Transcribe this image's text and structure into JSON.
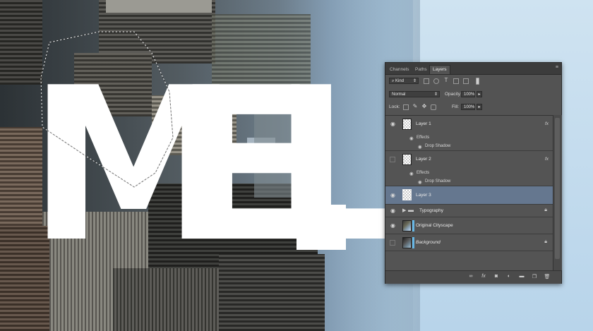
{
  "canvas_text": {
    "letter_1": "M",
    "letter_2": "E",
    "letter_3": "L"
  },
  "colors": {
    "panel_bg": "#535353",
    "selected_row": "#65778f",
    "mask_accent": "#67b7e5"
  },
  "layers_panel": {
    "tabs": [
      {
        "label": "Channels",
        "active": false
      },
      {
        "label": "Paths",
        "active": false
      },
      {
        "label": "Layers",
        "active": true
      }
    ],
    "panel_menu_icon": "panel-menu-icon",
    "filter": {
      "kind_label": "Kind",
      "icons": [
        "image-filter-icon",
        "adjustment-filter-icon",
        "type-filter-icon",
        "shape-filter-icon",
        "smart-object-filter-icon"
      ]
    },
    "blend_mode": "Normal",
    "opacity": {
      "label": "Opacity:",
      "value": "100%"
    },
    "lock": {
      "label": "Lock:",
      "icons": [
        "lock-transparent-icon",
        "lock-image-icon",
        "lock-position-icon",
        "lock-all-icon"
      ]
    },
    "fill": {
      "label": "Fill:",
      "value": "100%"
    },
    "layers": [
      {
        "name": "Layer 1",
        "visible": true,
        "selected": false,
        "fx": "fx",
        "effects_label": "Effects",
        "effect": "Drop Shadow"
      },
      {
        "name": "Layer 2",
        "visible": false,
        "selected": false,
        "fx": "fx",
        "effects_label": "Effects",
        "effect": "Drop Shadow"
      },
      {
        "name": "Layer 3",
        "visible": true,
        "selected": true
      },
      {
        "name": "Typography",
        "visible": true,
        "selected": false,
        "group": true,
        "locked": true
      },
      {
        "name": "Original Cityscape",
        "visible": true,
        "selected": false
      },
      {
        "name": "Background",
        "visible": false,
        "selected": false,
        "italic": true,
        "locked": true
      }
    ],
    "footer_icons": [
      "link-layers-icon",
      "add-style-icon",
      "add-mask-icon",
      "adjustment-layer-icon",
      "new-group-icon",
      "new-layer-icon",
      "delete-layer-icon"
    ],
    "footer_fx": "fx"
  }
}
